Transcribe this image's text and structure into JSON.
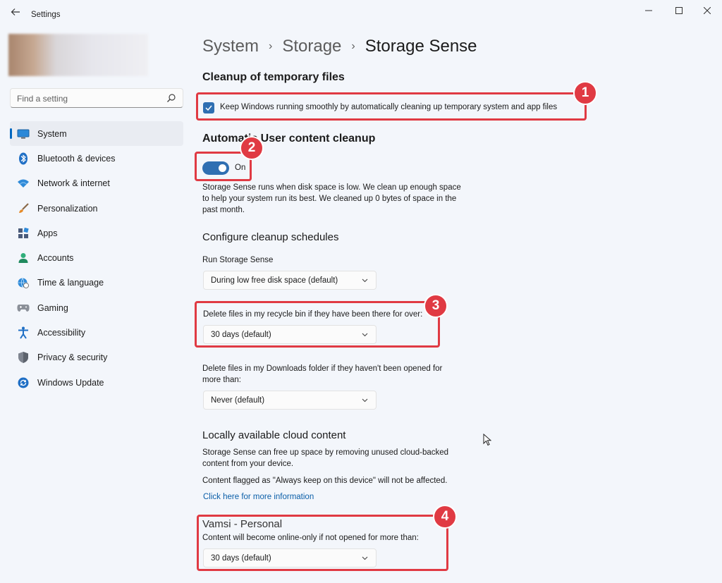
{
  "window": {
    "title": "Settings",
    "controls": {
      "minimize": "—",
      "maximize": "☐",
      "close": "✕"
    }
  },
  "sidebar": {
    "search_placeholder": "Find a setting",
    "items": [
      {
        "label": "System",
        "icon": "monitor-icon",
        "active": true
      },
      {
        "label": "Bluetooth & devices",
        "icon": "bluetooth-icon"
      },
      {
        "label": "Network & internet",
        "icon": "wifi-icon"
      },
      {
        "label": "Personalization",
        "icon": "brush-icon"
      },
      {
        "label": "Apps",
        "icon": "apps-icon"
      },
      {
        "label": "Accounts",
        "icon": "person-icon"
      },
      {
        "label": "Time & language",
        "icon": "globe-clock-icon"
      },
      {
        "label": "Gaming",
        "icon": "gamepad-icon"
      },
      {
        "label": "Accessibility",
        "icon": "accessibility-icon"
      },
      {
        "label": "Privacy & security",
        "icon": "shield-icon"
      },
      {
        "label": "Windows Update",
        "icon": "update-icon"
      }
    ]
  },
  "breadcrumb": {
    "part1": "System",
    "part2": "Storage",
    "part3": "Storage Sense",
    "separator": "›"
  },
  "cleanup": {
    "heading": "Cleanup of temporary files",
    "checkbox_label": "Keep Windows running smoothly by automatically cleaning up temporary system and app files",
    "checked": true
  },
  "auto_cleanup": {
    "heading": "Automatic User content cleanup",
    "toggle_state": "On",
    "description_line1": "Storage Sense runs when disk space is low. We clean up enough space",
    "description_line2": "to help your system run its best. We cleaned up 0 bytes of space in the",
    "description_line3": "past month."
  },
  "schedules": {
    "heading": "Configure cleanup schedules",
    "run_label": "Run Storage Sense",
    "run_value": "During low free disk space (default)",
    "recycle_label": "Delete files in my recycle bin if they have been there for over:",
    "recycle_value": "30 days (default)",
    "downloads_label_line1": "Delete files in my Downloads folder if they haven't been opened for",
    "downloads_label_line2": "more than:",
    "downloads_value": "Never (default)"
  },
  "cloud": {
    "heading": "Locally available cloud content",
    "desc_line1": "Storage Sense can free up space by removing unused cloud-backed",
    "desc_line2": "content from your device.",
    "flagged_note": "Content flagged as \"Always keep on this device\" will not be affected.",
    "link": "Click here for more information",
    "account_name": "Vamsi - Personal",
    "online_only_label": "Content will become online-only if not opened for more than:",
    "online_only_value": "30 days (default)"
  },
  "annotations": {
    "b1": "1",
    "b2": "2",
    "b3": "3",
    "b4": "4",
    "color": "#e03a43"
  },
  "colors": {
    "accent": "#2f6fb2",
    "link": "#0a5ea8",
    "background": "#f3f6fb"
  }
}
